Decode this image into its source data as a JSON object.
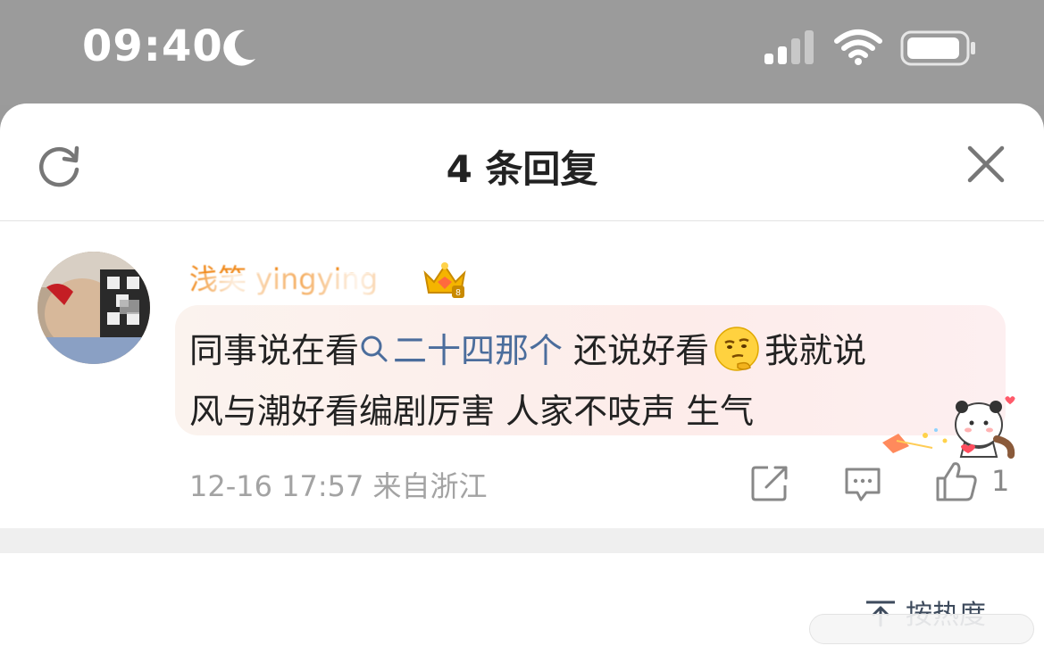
{
  "status_bar": {
    "time": "09:40",
    "icons": [
      "moon-icon",
      "cellular-signal-icon",
      "wifi-icon",
      "battery-icon"
    ]
  },
  "sheet": {
    "title": "4 条回复",
    "refresh_icon": "refresh-icon",
    "close_icon": "close-icon"
  },
  "comment": {
    "username": "浅笑 yingying",
    "badge_icon": "crown-badge-icon",
    "text_before_link": "同事说在看",
    "link_text": "二十四那个",
    "text_after_link": " 还说好看",
    "emoji": "thinking-face-emoji",
    "text_after_emoji": "我就说",
    "line2": "风与潮好看编剧厉害 人家不吱声 生气",
    "timestamp": "12-16 17:57",
    "source": "来自浙江",
    "like_count": "1",
    "colors": {
      "username": "#f08a1c",
      "link": "#4b6d9c",
      "meta": "#a3a3a3"
    }
  },
  "footer": {
    "sort_label": "按热度"
  }
}
